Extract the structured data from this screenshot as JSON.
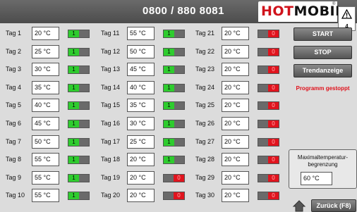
{
  "header": {
    "phone": "0800 / 880 8081",
    "logo_hot": "HOT",
    "logo_mobil": "MOBIL",
    "logo_reg": "®"
  },
  "alarm": {
    "count": "4",
    "icon": "warning-icon"
  },
  "days": [
    {
      "label": "Tag 1",
      "value": "20 °C",
      "on": true
    },
    {
      "label": "Tag 2",
      "value": "25 °C",
      "on": true
    },
    {
      "label": "Tag 3",
      "value": "30 °C",
      "on": true
    },
    {
      "label": "Tag 4",
      "value": "35 °C",
      "on": true
    },
    {
      "label": "Tag 5",
      "value": "40 °C",
      "on": true
    },
    {
      "label": "Tag 6",
      "value": "45 °C",
      "on": true
    },
    {
      "label": "Tag 7",
      "value": "50 °C",
      "on": true
    },
    {
      "label": "Tag 8",
      "value": "55 °C",
      "on": true
    },
    {
      "label": "Tag 9",
      "value": "55 °C",
      "on": true
    },
    {
      "label": "Tag 10",
      "value": "55 °C",
      "on": true
    },
    {
      "label": "Tag 11",
      "value": "55 °C",
      "on": true
    },
    {
      "label": "Tag 12",
      "value": "50 °C",
      "on": true
    },
    {
      "label": "Tag 13",
      "value": "45 °C",
      "on": true
    },
    {
      "label": "Tag 14",
      "value": "40 °C",
      "on": true
    },
    {
      "label": "Tag 15",
      "value": "35 °C",
      "on": true
    },
    {
      "label": "Tag 16",
      "value": "30 °C",
      "on": true
    },
    {
      "label": "Tag 17",
      "value": "25 °C",
      "on": true
    },
    {
      "label": "Tag 18",
      "value": "20 °C",
      "on": true
    },
    {
      "label": "Tag 19",
      "value": "20 °C",
      "on": false
    },
    {
      "label": "Tag 20",
      "value": "20 °C",
      "on": false
    },
    {
      "label": "Tag 21",
      "value": "20 °C",
      "on": false
    },
    {
      "label": "Tag 22",
      "value": "20 °C",
      "on": false
    },
    {
      "label": "Tag 23",
      "value": "20 °C",
      "on": false
    },
    {
      "label": "Tag 24",
      "value": "20 °C",
      "on": false
    },
    {
      "label": "Tag 25",
      "value": "20 °C",
      "on": false
    },
    {
      "label": "Tag 26",
      "value": "20 °C",
      "on": false
    },
    {
      "label": "Tag 27",
      "value": "20 °C",
      "on": false
    },
    {
      "label": "Tag 28",
      "value": "20 °C",
      "on": false
    },
    {
      "label": "Tag 29",
      "value": "20 °C",
      "on": false
    },
    {
      "label": "Tag 30",
      "value": "20 °C",
      "on": false
    }
  ],
  "switch_text": {
    "on": "1",
    "off": "0"
  },
  "buttons": {
    "start": "START",
    "stop": "STOP",
    "trend": "Trendanzeige",
    "back": "Zurück (F8)"
  },
  "status": "Programm gestoppt",
  "max_temp": {
    "label_line1": "Maximaltemperatur-",
    "label_line2": "begrenzung",
    "value": "60 °C"
  },
  "colors": {
    "switch_on": "#2ecc2e",
    "switch_off": "#e0141e",
    "status_text": "#e0101a",
    "brand_red": "#d0121b"
  }
}
